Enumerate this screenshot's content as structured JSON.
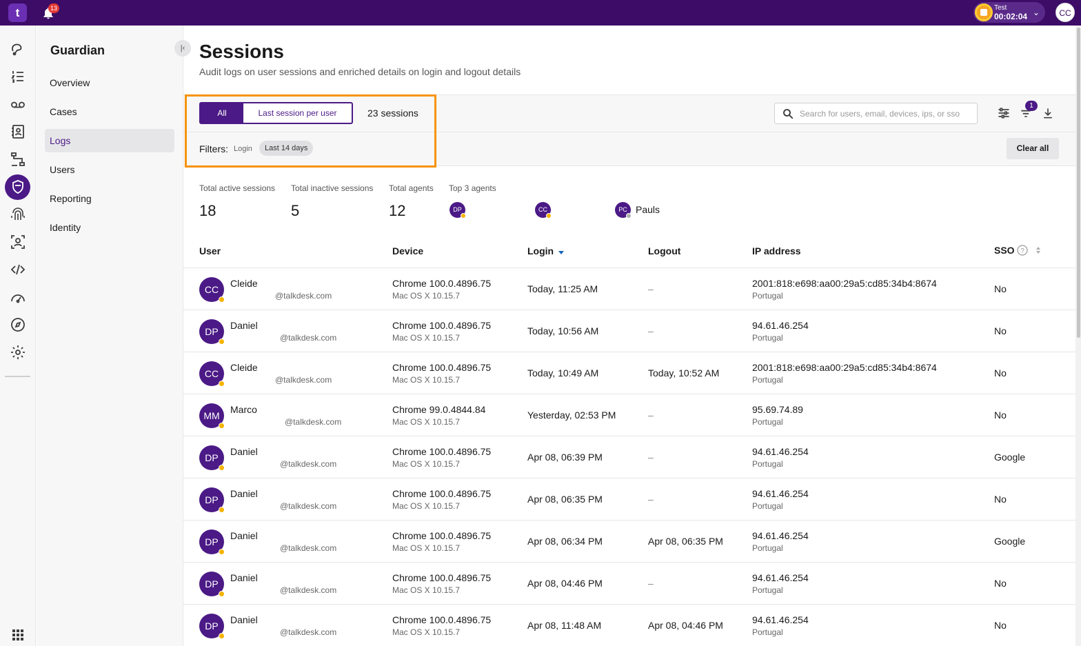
{
  "topbar": {
    "logo": "t",
    "notification_count": "13",
    "status_name": "Test",
    "status_time": "00:02:04",
    "user_initials": "CC"
  },
  "rail": {
    "icons": [
      "conversations-icon",
      "list-icon",
      "voicemail-icon",
      "contacts-icon",
      "flows-icon",
      "guardian-shield-icon",
      "fingerprint-icon",
      "identity-icon",
      "code-icon",
      "dashboard-icon",
      "compass-icon",
      "gear-icon",
      "apps-grid-icon"
    ]
  },
  "subnav": {
    "title": "Guardian",
    "items": [
      {
        "label": "Overview",
        "active": false
      },
      {
        "label": "Cases",
        "active": false
      },
      {
        "label": "Logs",
        "active": true
      },
      {
        "label": "Users",
        "active": false
      },
      {
        "label": "Reporting",
        "active": false
      },
      {
        "label": "Identity",
        "active": false
      }
    ]
  },
  "page": {
    "title": "Sessions",
    "subtitle": "Audit logs on user sessions and enriched details on login and logout details"
  },
  "toolbar": {
    "seg_all": "All",
    "seg_last": "Last session per user",
    "sessions_count": "23 sessions",
    "search_placeholder": "Search for users, email, devices, ips, or sso",
    "filter_badge": "1"
  },
  "filters": {
    "label": "Filters:",
    "type": "Login",
    "chip": "Last 14 days",
    "clear_all": "Clear all"
  },
  "stats": {
    "active_label": "Total active sessions",
    "active_value": "18",
    "inactive_label": "Total inactive sessions",
    "inactive_value": "5",
    "agents_label": "Total agents",
    "agents_value": "12",
    "top_label": "Top 3 agents",
    "top_agents": [
      {
        "initials": "DP",
        "name": ""
      },
      {
        "initials": "CC",
        "name": ""
      },
      {
        "initials": "PC",
        "name": "Pauls"
      }
    ]
  },
  "table": {
    "headers": {
      "user": "User",
      "device": "Device",
      "login": "Login",
      "logout": "Logout",
      "ip": "IP address",
      "sso": "SSO"
    },
    "rows": [
      {
        "initials": "CC",
        "name": "Cleide",
        "email": "@talkdesk.com",
        "browser": "Chrome 100.0.4896.75",
        "os": "Mac OS X 10.15.7",
        "login": "Today, 11:25 AM",
        "logout": "–",
        "ip": "2001:818:e698:aa00:29a5:cd85:34b4:8674",
        "country": "Portugal",
        "sso": "No"
      },
      {
        "initials": "DP",
        "name": "Daniel",
        "email": "@talkdesk.com",
        "browser": "Chrome 100.0.4896.75",
        "os": "Mac OS X 10.15.7",
        "login": "Today, 10:56 AM",
        "logout": "–",
        "ip": "94.61.46.254",
        "country": "Portugal",
        "sso": "No"
      },
      {
        "initials": "CC",
        "name": "Cleide",
        "email": "@talkdesk.com",
        "browser": "Chrome 100.0.4896.75",
        "os": "Mac OS X 10.15.7",
        "login": "Today, 10:49 AM",
        "logout": "Today, 10:52 AM",
        "ip": "2001:818:e698:aa00:29a5:cd85:34b4:8674",
        "country": "Portugal",
        "sso": "No"
      },
      {
        "initials": "MM",
        "name": "Marco",
        "email": "@talkdesk.com",
        "browser": "Chrome 99.0.4844.84",
        "os": "Mac OS X 10.15.7",
        "login": "Yesterday, 02:53 PM",
        "logout": "–",
        "ip": "95.69.74.89",
        "country": "Portugal",
        "sso": "No"
      },
      {
        "initials": "DP",
        "name": "Daniel",
        "email": "@talkdesk.com",
        "browser": "Chrome 100.0.4896.75",
        "os": "Mac OS X 10.15.7",
        "login": "Apr 08, 06:39 PM",
        "logout": "–",
        "ip": "94.61.46.254",
        "country": "Portugal",
        "sso": "Google"
      },
      {
        "initials": "DP",
        "name": "Daniel",
        "email": "@talkdesk.com",
        "browser": "Chrome 100.0.4896.75",
        "os": "Mac OS X 10.15.7",
        "login": "Apr 08, 06:35 PM",
        "logout": "–",
        "ip": "94.61.46.254",
        "country": "Portugal",
        "sso": "No"
      },
      {
        "initials": "DP",
        "name": "Daniel",
        "email": "@talkdesk.com",
        "browser": "Chrome 100.0.4896.75",
        "os": "Mac OS X 10.15.7",
        "login": "Apr 08, 06:34 PM",
        "logout": "Apr 08, 06:35 PM",
        "ip": "94.61.46.254",
        "country": "Portugal",
        "sso": "Google"
      },
      {
        "initials": "DP",
        "name": "Daniel",
        "email": "@talkdesk.com",
        "browser": "Chrome 100.0.4896.75",
        "os": "Mac OS X 10.15.7",
        "login": "Apr 08, 04:46 PM",
        "logout": "–",
        "ip": "94.61.46.254",
        "country": "Portugal",
        "sso": "No"
      },
      {
        "initials": "DP",
        "name": "Daniel",
        "email": "@talkdesk.com",
        "browser": "Chrome 100.0.4896.75",
        "os": "Mac OS X 10.15.7",
        "login": "Apr 08, 11:48 AM",
        "logout": "Apr 08, 04:46 PM",
        "ip": "94.61.46.254",
        "country": "Portugal",
        "sso": "No"
      }
    ]
  },
  "colors": {
    "topbar": "#3c0c66",
    "accent": "#4b1a86",
    "highlight": "#f7930b",
    "presence": "#f5b400"
  }
}
